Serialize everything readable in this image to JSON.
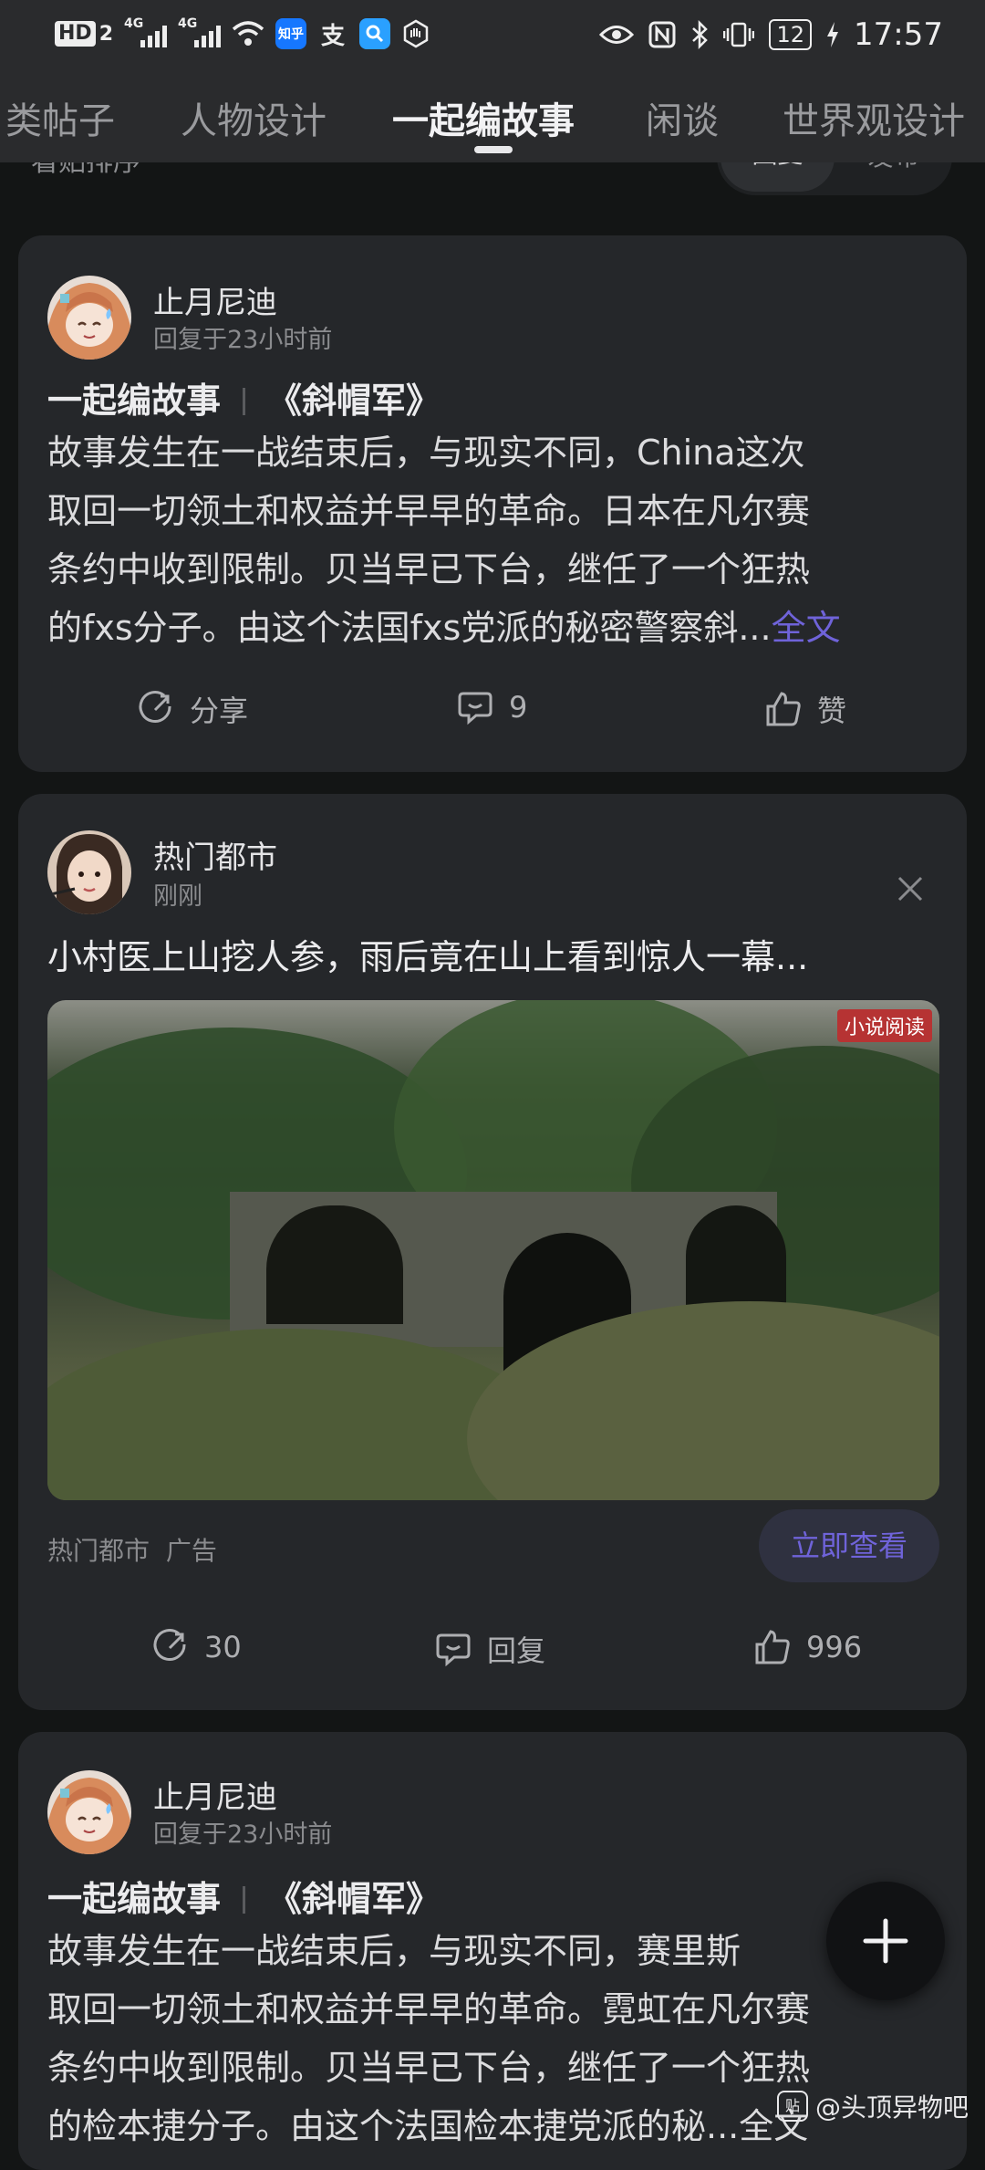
{
  "status_bar": {
    "hd_badge": "HD",
    "sim_number": "2",
    "sig1_label": "4G",
    "sig2_label": "4G",
    "zhihu_label": "知乎",
    "alipay_label": "支",
    "battery": "12",
    "time": "17:57"
  },
  "tabs": [
    {
      "label": "类帖子"
    },
    {
      "label": "人物设计"
    },
    {
      "label": "一起编故事",
      "active": true
    },
    {
      "label": "闲谈"
    },
    {
      "label": "世界观设计"
    }
  ],
  "sort": {
    "label": "看贴排序",
    "options": [
      "回复",
      "发布"
    ],
    "selected": "回复"
  },
  "posts": [
    {
      "author": "止月尼迪",
      "meta": "回复于23小时前",
      "category": "一起编故事",
      "title": "《斜帽军》",
      "lines": [
        "故事发生在一战结束后，与现实不同，China这次",
        "取回一切领土和权益并早早的革命。日本在凡尔赛",
        "条约中收到限制。贝当早已下台，继任了一个狂热",
        "的fxs分子。由这个法国fxs党派的秘密警察斜..."
      ],
      "more_label": "全文",
      "share_label": "分享",
      "comments": "9",
      "like_label": "赞"
    },
    {
      "author": "止月尼迪",
      "meta": "回复于23小时前",
      "category": "一起编故事",
      "title": "《斜帽军》",
      "lines": [
        "故事发生在一战结束后，与现实不同，赛里斯",
        "取回一切领土和权益并早早的革命。霓虹在凡尔赛",
        "条约中收到限制。贝当早已下台，继任了一个狂热",
        "的检本捷分子。由这个法国检本捷党派的秘...全文"
      ]
    }
  ],
  "ad": {
    "author": "热门都市",
    "meta": "刚刚",
    "headline": "小村医上山挖人参，雨后竟在山上看到惊人一幕...",
    "image_badge": "小说阅读",
    "source": "热门都市",
    "ad_label": "广告",
    "cta": "立即查看",
    "shares": "30",
    "reply_label": "回复",
    "likes": "996"
  },
  "watermark": "@头顶异物吧",
  "colors": {
    "background": "#131515",
    "card": "#25272a",
    "accent": "#6f63d9",
    "muted_text": "#8a8b8e"
  }
}
